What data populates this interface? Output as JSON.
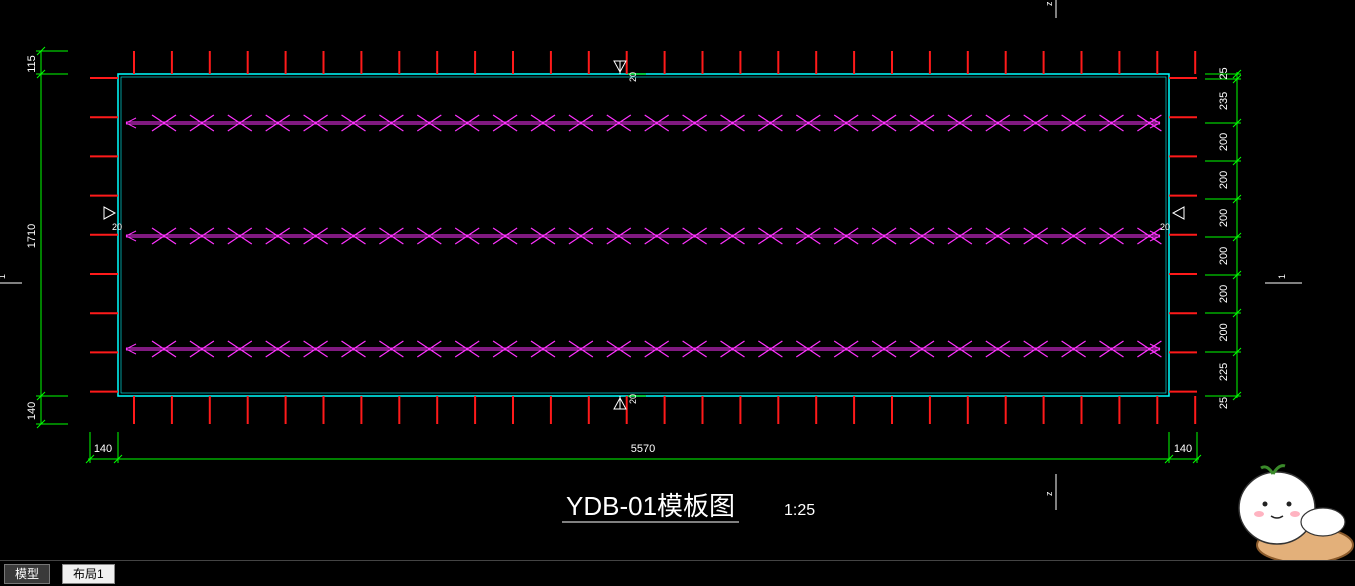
{
  "drawing": {
    "title": "YDB-01模板图",
    "scale": "1:25",
    "section_mark": "1",
    "section_mark_z": "z",
    "cover_label": "20",
    "dims_left": {
      "top": "115",
      "middle": "1710",
      "bottom": "140"
    },
    "dims_bottom": {
      "left": "140",
      "middle": "5570",
      "right": "140"
    },
    "dims_right": [
      "25",
      "235",
      "200",
      "200",
      "200",
      "200",
      "200",
      "200",
      "225",
      "25"
    ]
  },
  "colors": {
    "background": "#000000",
    "slab_outline": "#00ffff",
    "rebar": "#ff1a1a",
    "lifting_line": "#ff33ff",
    "dimension": "#00ff00",
    "text": "#ffffff"
  },
  "tabs": [
    {
      "label": "模型",
      "active": true
    },
    {
      "label": "布局1",
      "active": false
    }
  ]
}
